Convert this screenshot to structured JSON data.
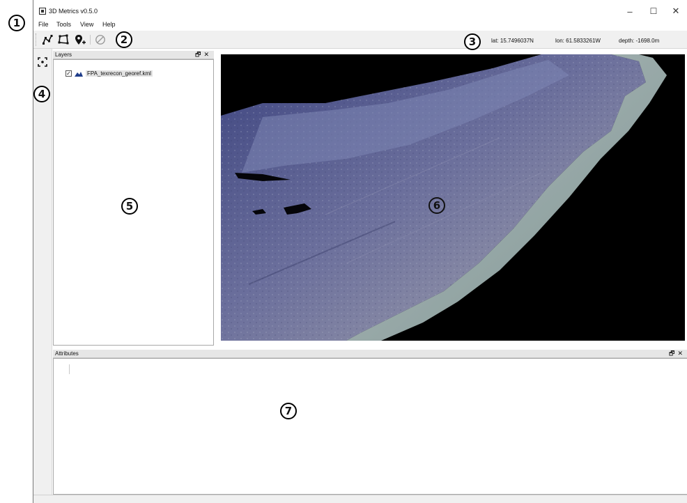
{
  "window": {
    "title": "3D Metrics v0.5.0",
    "minimize": "–",
    "maximize": "☐",
    "close": "✕"
  },
  "menu": {
    "items": [
      "File",
      "Tools",
      "View",
      "Help"
    ]
  },
  "toolbar": {
    "buttons": [
      {
        "icon": "polyline-icon"
      },
      {
        "icon": "polygon-icon"
      },
      {
        "icon": "add-point-icon"
      },
      {
        "icon": "disabled-icon"
      }
    ],
    "status": {
      "lat": "lat: 15.7496037N",
      "lon": "lon: 61.5833261W",
      "depth": "depth: -1698.0m"
    }
  },
  "sidebar": {
    "buttons": [
      {
        "icon": "center-view-icon"
      }
    ]
  },
  "layers_dock": {
    "title": "Layers",
    "float": "🗗",
    "close": "✕",
    "items": [
      {
        "checked": true,
        "check_glyph": "✓",
        "name": "FPA_texrecon_georef.kml"
      }
    ]
  },
  "attributes_dock": {
    "title": "Attributes",
    "float": "🗗",
    "close": "✕"
  },
  "callouts": [
    "1",
    "2",
    "3",
    "4",
    "5",
    "6",
    "7"
  ],
  "colors": {
    "viewport_bg": "#000000",
    "seafloor_dark": "#4a4e86",
    "seafloor_mid": "#7a7d9a",
    "seafloor_light": "#9fb7b8"
  }
}
